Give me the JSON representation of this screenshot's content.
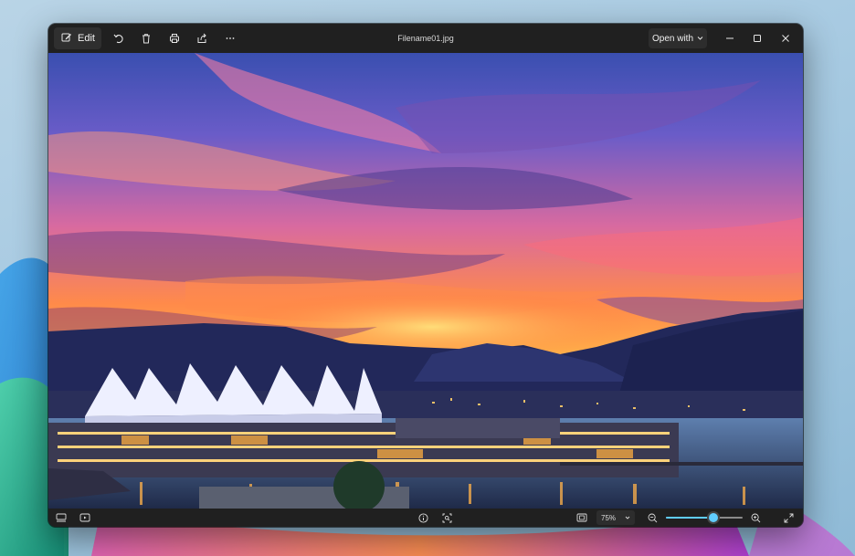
{
  "toolbar": {
    "edit_label": "Edit",
    "icons": [
      "edit-icon",
      "rotate-icon",
      "delete-icon",
      "print-icon",
      "share-icon",
      "more-icon"
    ]
  },
  "title": {
    "filename": "Filename01.jpg"
  },
  "header_actions": {
    "open_with_label": "Open with",
    "window_controls": [
      "minimize-icon",
      "maximize-icon",
      "close-icon"
    ]
  },
  "bottom": {
    "left_icons": [
      "filmstrip-icon",
      "slideshow-icon"
    ],
    "center_icons": [
      "info-icon",
      "visual-search-icon"
    ],
    "zoom_label": "75%",
    "zoom_level_percent": 75,
    "slider_fill_fraction": 0.62,
    "right_icons": [
      "fit-to-window-icon",
      "zoom-out-icon",
      "zoom-in-icon",
      "fullscreen-icon"
    ]
  },
  "colors": {
    "accent": "#60cdff",
    "chrome_bg": "#202020",
    "button_bg": "#2f2f2f"
  }
}
